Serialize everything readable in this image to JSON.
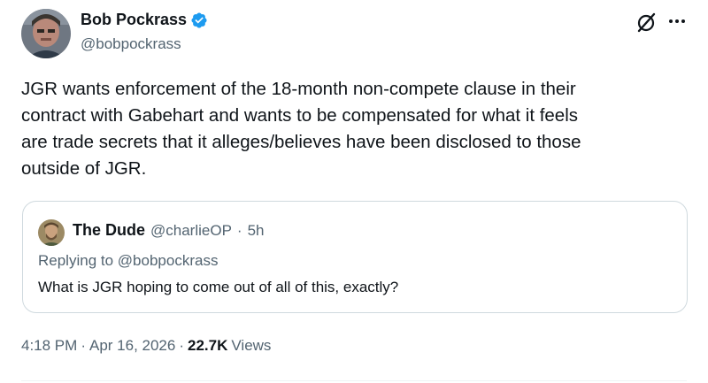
{
  "author": {
    "display_name": "Bob Pockrass",
    "handle": "@bobpockrass",
    "verified": true
  },
  "tweet": {
    "text": "JGR wants enforcement of the 18-month non-compete clause in their\ncontract with Gabehart and wants to be compensated for what it feels\nare trade secrets that it alleges/believes have been disclosed to those\noutside of JGR.",
    "time": "4:18 PM",
    "sep1": "·",
    "date": "Apr 16, 2026",
    "sep2": "·",
    "views_count": "22.7K",
    "views_label": "Views"
  },
  "quote": {
    "display_name": "The Dude",
    "handle": "@charlieOP",
    "sep": "·",
    "age": "5h",
    "replying_prefix": "Replying to",
    "replying_to": "@bobpockrass",
    "text": "What is JGR hoping to come out of all of this, exactly?"
  },
  "icons": {
    "verified": "verified-badge-icon",
    "grok": "grok-icon",
    "more": "more-options-icon"
  },
  "colors": {
    "primary_text": "#0f1419",
    "secondary_text": "#536471",
    "verified_blue": "#1d9bf0",
    "border": "#cfd9de"
  }
}
